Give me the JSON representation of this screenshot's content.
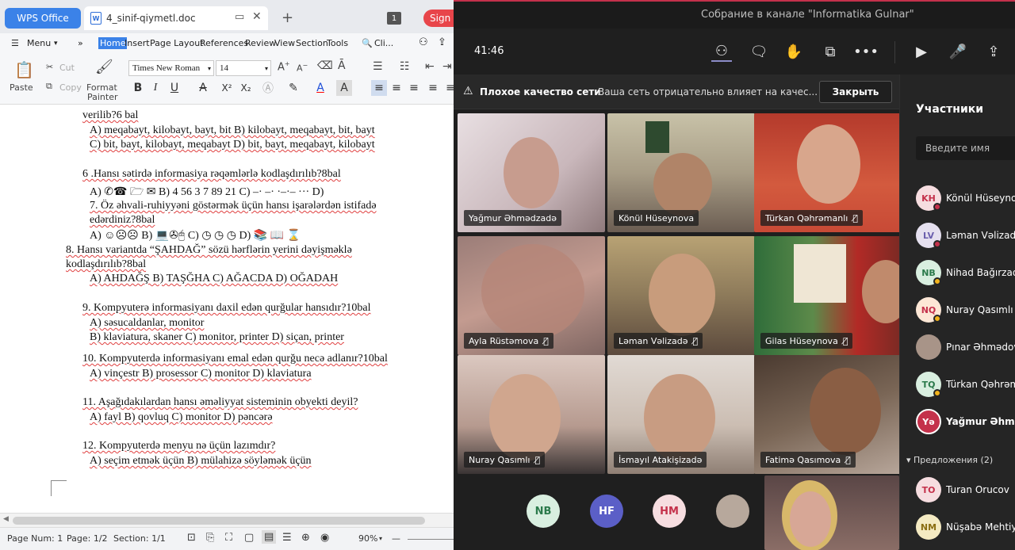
{
  "wps": {
    "app_tab": "WPS Office",
    "doc_tab": "4_sinif-qiymetl.doc",
    "doc_icon": "W",
    "tab_count": "1",
    "sign_in": "Sign in",
    "menu": {
      "menu_label": "Menu",
      "items": [
        "Home",
        "Insert",
        "Page Layout",
        "References",
        "Review",
        "View",
        "Section",
        "Tools"
      ],
      "search": "Cli..."
    },
    "ribbon": {
      "paste": "Paste",
      "cut": "Cut",
      "copy": "Copy",
      "format_painter_1": "Format",
      "format_painter_2": "Painter",
      "font_name": "Times New Roman",
      "font_size": "14"
    },
    "doc_lines": [
      "verilib?6 bal",
      "A) meqabayt, kilobayt, bayt, bit   B) kilobayt, meqabayt, bit, bayt",
      "C) bit, bayt, kilobayt, meqabayt     D) bit, bayt, meqabayt, kilobayt",
      "6 .Hansı sətirdə informasiya rəqəmlərlə kodlaşdırılıb?8bal",
      "A) ✆☎ 🗁 ✉      B) 4 56  3  7 89  21     C) –·  –· ·–·–  ···  D)",
      "7.   Öz   əhvali-ruhiyyəni   göstərmək   üçün   hansı   işarələrdən   istifadə",
      "edərdiniz?8bal",
      "A) ☺☹☹        B) 💻✇🖰        C) ◷ ◷ ◷        D) 📚 📖 ⌛",
      "8. Hansı variantda “ŞAHDAĞ” sözü hərflərin yerini dəyişməklə",
      "kodlaşdırılıb?8bal",
      "A) AHDAĞŞ       B) TAŞĞHA      C) AĞACDA    D) OĞADAH",
      "9. Kompyuterə informasiyanı daxil edən qurğular hansıdır?10bal",
      "A) səsucaldanlar, monitor",
      "B) klaviatura, skaner    C) monitor, printer    D) siçan, printer",
      "10. Kompyuterdə informasiyanı emal edən qurğu necə adlanır?10bal",
      "A) vinçestr   B) prosessor   C) monitor   D) klaviatura",
      "11. Aşağıdakılardan hansı əməliyyat sisteminin obyekti deyil?",
      "A) fayl           B) qovluq     C) monitor    D) pəncərə",
      "12. Kompyuterdə menyu nə üçün lazımdır?",
      "A) seçim etmək üçün      B) mülahizə söyləmək üçün"
    ],
    "status": {
      "page_num": "Page Num: 1",
      "page": "Page: 1/2",
      "section": "Section: 1/1",
      "zoom": "90%"
    }
  },
  "teams": {
    "window_title": "Собрание в канале \"Informatika Gulnar\"",
    "timer": "41:46",
    "warning": {
      "title": "Плохое качество сети",
      "text": "Ваша сеть отрицательно влияет на качес...",
      "close": "Закрыть"
    },
    "tiles": [
      {
        "name": "Yağmur Əhmədzadə",
        "muted": false
      },
      {
        "name": "Könül Hüseynova",
        "muted": false
      },
      {
        "name": "Türkan Qəhrəmanlı",
        "muted": true
      },
      {
        "name": "Ayla Rüstəmova",
        "muted": true
      },
      {
        "name": "Ləman Vəlizadə",
        "muted": true
      },
      {
        "name": "Gilas Hüseynova",
        "muted": true
      },
      {
        "name": "Nuray Qasımlı",
        "muted": true
      },
      {
        "name": "İsmayıl Atakişizadə",
        "muted": false
      },
      {
        "name": "Fatimə Qasımova",
        "muted": true
      }
    ],
    "bottom_avatars": [
      "NB",
      "HF",
      "HM",
      ""
    ],
    "panel": {
      "title": "Участники",
      "search_placeholder": "Введите имя",
      "participants": [
        {
          "initials": "KH",
          "name": "Könül Hüseynova"
        },
        {
          "initials": "LV",
          "name": "Ləman Vəlizadə"
        },
        {
          "initials": "NB",
          "name": "Nihad Bağırzadə"
        },
        {
          "initials": "NQ",
          "name": "Nuray Qasımlı"
        },
        {
          "initials": "",
          "name": "Pınar Əhmədova"
        },
        {
          "initials": "TQ",
          "name": "Türkan Qəhrəmanlı"
        },
        {
          "initials": "Yə",
          "name": "Yağmur Əhmədzadə"
        }
      ],
      "suggestions_label": "Предложения (2)",
      "suggestions": [
        {
          "initials": "TO",
          "name": "Turan Orucov"
        },
        {
          "initials": "NM",
          "name": "Nüşabə Mehtiyeva"
        }
      ]
    },
    "colors": {
      "accent": "#c4314b",
      "status_away": "#f1b31c"
    }
  }
}
